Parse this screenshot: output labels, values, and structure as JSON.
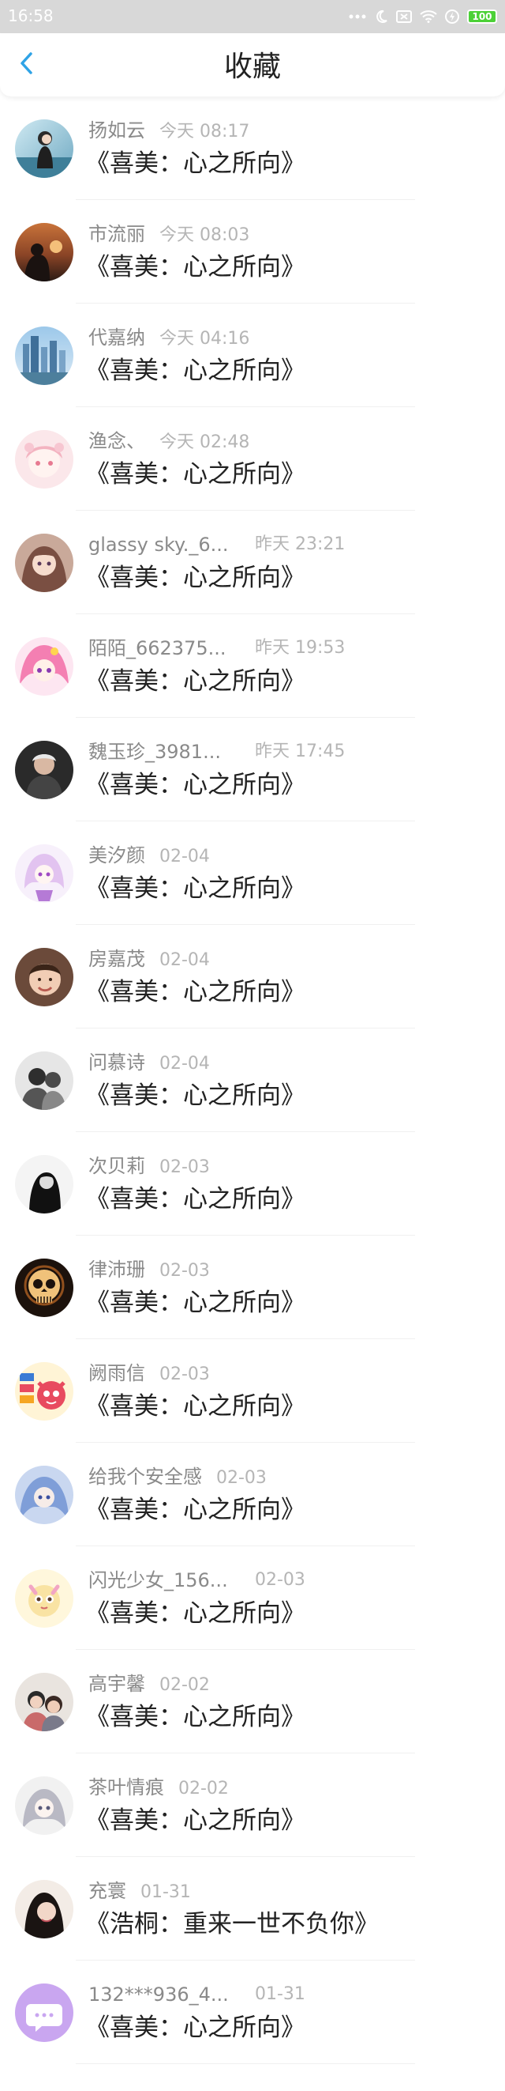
{
  "status_bar": {
    "time": "16:58",
    "battery": "100",
    "icons": [
      "signal-dots-icon",
      "moon-icon",
      "sim-icon",
      "wifi-icon",
      "charging-icon",
      "battery-icon"
    ]
  },
  "header": {
    "title": "收藏",
    "back_icon": "chevron-left-icon",
    "accent_color": "#2fa3e6"
  },
  "items": [
    {
      "name": "扬如云",
      "time": "今天 08:17",
      "title": "《喜美：心之所向》",
      "avatar": "photo-avatar"
    },
    {
      "name": "市流丽",
      "time": "今天 08:03",
      "title": "《喜美：心之所向》",
      "avatar": "photo-avatar"
    },
    {
      "name": "代嘉纳",
      "time": "今天 04:16",
      "title": "《喜美：心之所向》",
      "avatar": "photo-avatar"
    },
    {
      "name": "渔念、",
      "time": "今天 02:48",
      "title": "《喜美：心之所向》",
      "avatar": "anime-avatar"
    },
    {
      "name": "glassy sky._6...",
      "time": "昨天 23:21",
      "title": "《喜美：心之所向》",
      "avatar": "anime-avatar"
    },
    {
      "name": "陌陌_662375...",
      "time": "昨天 19:53",
      "title": "《喜美：心之所向》",
      "avatar": "anime-avatar"
    },
    {
      "name": "魏玉珍_3981...",
      "time": "昨天 17:45",
      "title": "《喜美：心之所向》",
      "avatar": "photo-avatar"
    },
    {
      "name": "美汐颜",
      "time": "02-04",
      "title": "《喜美：心之所向》",
      "avatar": "anime-avatar"
    },
    {
      "name": "房嘉茂",
      "time": "02-04",
      "title": "《喜美：心之所向》",
      "avatar": "photo-avatar"
    },
    {
      "name": "问慕诗",
      "time": "02-04",
      "title": "《喜美：心之所向》",
      "avatar": "photo-avatar"
    },
    {
      "name": "次贝莉",
      "time": "02-03",
      "title": "《喜美：心之所向》",
      "avatar": "photo-avatar"
    },
    {
      "name": "律沛珊",
      "time": "02-03",
      "title": "《喜美：心之所向》",
      "avatar": "skull-avatar"
    },
    {
      "name": "阙雨信",
      "time": "02-03",
      "title": "《喜美：心之所向》",
      "avatar": "cartoon-avatar"
    },
    {
      "name": "给我个安全感",
      "time": "02-03",
      "title": "《喜美：心之所向》",
      "avatar": "anime-avatar"
    },
    {
      "name": "闪光少女_156...",
      "time": "02-03",
      "title": "《喜美：心之所向》",
      "avatar": "cartoon-avatar"
    },
    {
      "name": "高宇馨",
      "time": "02-02",
      "title": "《喜美：心之所向》",
      "avatar": "photo-avatar"
    },
    {
      "name": "茶叶情痕",
      "time": "02-02",
      "title": "《喜美：心之所向》",
      "avatar": "anime-avatar"
    },
    {
      "name": "充寰",
      "time": "01-31",
      "title": "《浩桐：重来一世不负你》",
      "avatar": "photo-avatar"
    },
    {
      "name": "132***936_4...",
      "time": "01-31",
      "title": "《喜美：心之所向》",
      "avatar": "default-chat-avatar"
    }
  ]
}
